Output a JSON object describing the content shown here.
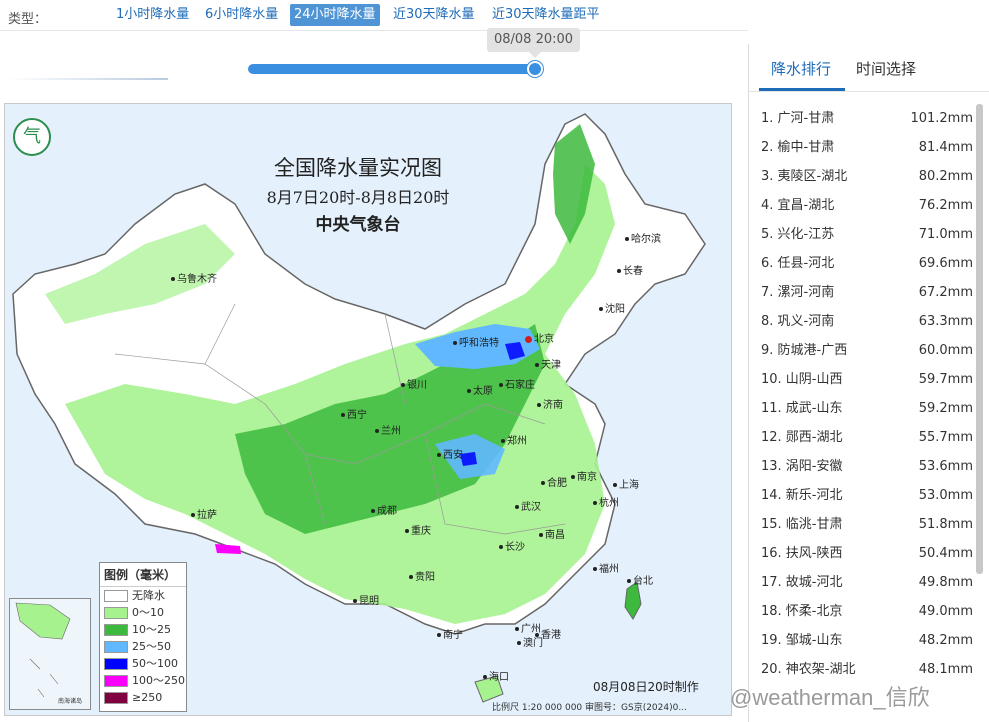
{
  "typebar": {
    "label": "类型：",
    "tabs": [
      "1小时降水量",
      "6小时降水量",
      "24小时降水量",
      "近30天降水量",
      "近30天降水量距平"
    ],
    "active_index": 2
  },
  "slider": {
    "time_label": "08/08 20:00",
    "position_fraction": 1.0
  },
  "map": {
    "title": "全国降水量实况图",
    "subtitle": "8月7日20时-8月8日20时",
    "agency": "中央气象台",
    "cities": [
      "乌鲁木齐",
      "哈尔滨",
      "长春",
      "沈阳",
      "呼和浩特",
      "北京",
      "天津",
      "银川",
      "太原",
      "石家庄",
      "济南",
      "西宁",
      "兰州",
      "郑州",
      "西安",
      "合肥",
      "南京",
      "上海",
      "杭州",
      "成都",
      "武汉",
      "重庆",
      "南昌",
      "长沙",
      "拉萨",
      "贵阳",
      "福州",
      "台北",
      "昆明",
      "广州",
      "南宁",
      "澳门",
      "香港",
      "海口"
    ],
    "legend": {
      "title": "图例（毫米）",
      "items": [
        {
          "label": "无降水",
          "color": "#ffffff"
        },
        {
          "label": "0～10",
          "color": "#a6f28f"
        },
        {
          "label": "10～25",
          "color": "#3dba3d"
        },
        {
          "label": "25～50",
          "color": "#61b8ff"
        },
        {
          "label": "50～100",
          "color": "#0000ff"
        },
        {
          "label": "100～250",
          "color": "#fa00fa"
        },
        {
          "label": "≥250",
          "color": "#800040"
        }
      ]
    },
    "inset_label": "南海诸岛",
    "made_text": "08月08日20时制作",
    "scale_text": "比例尺 1:20 000 000    审图号：GS京(2024)0..."
  },
  "panel": {
    "tabs": [
      "降水排行",
      "时间选择"
    ],
    "active_index": 0,
    "ranking": [
      {
        "name": "1. 广河-甘肃",
        "value": "101.2mm"
      },
      {
        "name": "2. 榆中-甘肃",
        "value": "81.4mm"
      },
      {
        "name": "3. 夷陵区-湖北",
        "value": "80.2mm"
      },
      {
        "name": "4. 宜昌-湖北",
        "value": "76.2mm"
      },
      {
        "name": "5. 兴化-江苏",
        "value": "71.0mm"
      },
      {
        "name": "6. 任县-河北",
        "value": "69.6mm"
      },
      {
        "name": "7. 漯河-河南",
        "value": "67.2mm"
      },
      {
        "name": "8. 巩义-河南",
        "value": "63.3mm"
      },
      {
        "name": "9. 防城港-广西",
        "value": "60.0mm"
      },
      {
        "name": "10. 山阴-山西",
        "value": "59.7mm"
      },
      {
        "name": "11. 成武-山东",
        "value": "59.2mm"
      },
      {
        "name": "12. 郧西-湖北",
        "value": "55.7mm"
      },
      {
        "name": "13. 涡阳-安徽",
        "value": "53.6mm"
      },
      {
        "name": "14. 新乐-河北",
        "value": "53.0mm"
      },
      {
        "name": "15. 临洮-甘肃",
        "value": "51.8mm"
      },
      {
        "name": "16. 扶风-陕西",
        "value": "50.4mm"
      },
      {
        "name": "17. 故城-河北",
        "value": "49.8mm"
      },
      {
        "name": "18. 怀柔-北京",
        "value": "49.0mm"
      },
      {
        "name": "19. 邹城-山东",
        "value": "48.2mm"
      },
      {
        "name": "20. 神农架-湖北",
        "value": "48.1mm"
      }
    ]
  },
  "watermark": "@weatherman_信欣"
}
